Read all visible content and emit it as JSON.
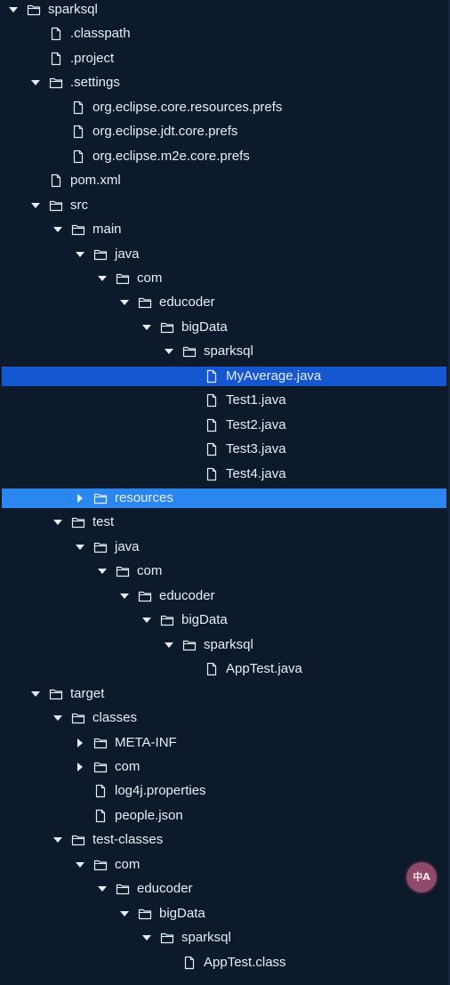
{
  "rows": [
    {
      "label": "sparksql",
      "depth": 0,
      "kind": "folder",
      "expanded": true
    },
    {
      "label": ".classpath",
      "depth": 1,
      "kind": "file"
    },
    {
      "label": ".project",
      "depth": 1,
      "kind": "file"
    },
    {
      "label": ".settings",
      "depth": 1,
      "kind": "folder",
      "expanded": true
    },
    {
      "label": "org.eclipse.core.resources.prefs",
      "depth": 2,
      "kind": "file"
    },
    {
      "label": "org.eclipse.jdt.core.prefs",
      "depth": 2,
      "kind": "file"
    },
    {
      "label": "org.eclipse.m2e.core.prefs",
      "depth": 2,
      "kind": "file"
    },
    {
      "label": "pom.xml",
      "depth": 1,
      "kind": "file"
    },
    {
      "label": "src",
      "depth": 1,
      "kind": "folder",
      "expanded": true
    },
    {
      "label": "main",
      "depth": 2,
      "kind": "folder",
      "expanded": true
    },
    {
      "label": "java",
      "depth": 3,
      "kind": "folder",
      "expanded": true
    },
    {
      "label": "com",
      "depth": 4,
      "kind": "folder",
      "expanded": true
    },
    {
      "label": "educoder",
      "depth": 5,
      "kind": "folder",
      "expanded": true
    },
    {
      "label": "bigData",
      "depth": 6,
      "kind": "folder",
      "expanded": true
    },
    {
      "label": "sparksql",
      "depth": 7,
      "kind": "folder",
      "expanded": true
    },
    {
      "label": "MyAverage.java",
      "depth": 8,
      "kind": "file",
      "state": "selected"
    },
    {
      "label": "Test1.java",
      "depth": 8,
      "kind": "file"
    },
    {
      "label": "Test2.java",
      "depth": 8,
      "kind": "file"
    },
    {
      "label": "Test3.java",
      "depth": 8,
      "kind": "file"
    },
    {
      "label": "Test4.java",
      "depth": 8,
      "kind": "file"
    },
    {
      "label": "resources",
      "depth": 3,
      "kind": "folder",
      "expanded": false,
      "state": "hover"
    },
    {
      "label": "test",
      "depth": 2,
      "kind": "folder",
      "expanded": true
    },
    {
      "label": "java",
      "depth": 3,
      "kind": "folder",
      "expanded": true
    },
    {
      "label": "com",
      "depth": 4,
      "kind": "folder",
      "expanded": true
    },
    {
      "label": "educoder",
      "depth": 5,
      "kind": "folder",
      "expanded": true
    },
    {
      "label": "bigData",
      "depth": 6,
      "kind": "folder",
      "expanded": true
    },
    {
      "label": "sparksql",
      "depth": 7,
      "kind": "folder",
      "expanded": true
    },
    {
      "label": "AppTest.java",
      "depth": 8,
      "kind": "file"
    },
    {
      "label": "target",
      "depth": 1,
      "kind": "folder",
      "expanded": true
    },
    {
      "label": "classes",
      "depth": 2,
      "kind": "folder",
      "expanded": true
    },
    {
      "label": "META-INF",
      "depth": 3,
      "kind": "folder",
      "expanded": false
    },
    {
      "label": "com",
      "depth": 3,
      "kind": "folder",
      "expanded": false
    },
    {
      "label": "log4j.properties",
      "depth": 3,
      "kind": "file"
    },
    {
      "label": "people.json",
      "depth": 3,
      "kind": "file"
    },
    {
      "label": "test-classes",
      "depth": 2,
      "kind": "folder",
      "expanded": true
    },
    {
      "label": "com",
      "depth": 3,
      "kind": "folder",
      "expanded": true
    },
    {
      "label": "educoder",
      "depth": 4,
      "kind": "folder",
      "expanded": true
    },
    {
      "label": "bigData",
      "depth": 5,
      "kind": "folder",
      "expanded": true
    },
    {
      "label": "sparksql",
      "depth": 6,
      "kind": "folder",
      "expanded": true
    },
    {
      "label": "AppTest.class",
      "depth": 7,
      "kind": "file"
    }
  ],
  "translate_badge": {
    "label": "中A",
    "icon": "translate-icon"
  },
  "colors": {
    "background": "#0c1a2b",
    "text": "#e8edf3",
    "selected": "#1557d1",
    "hover": "#2b87f0",
    "badge": "#8f4a67"
  }
}
